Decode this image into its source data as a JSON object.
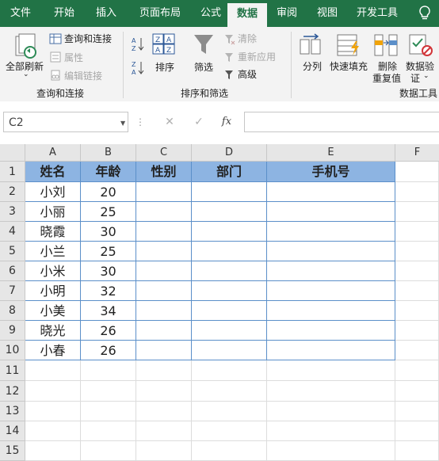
{
  "tabs": [
    {
      "label": "文件",
      "active": false
    },
    {
      "label": "开始",
      "active": false
    },
    {
      "label": "插入",
      "active": false
    },
    {
      "label": "页面布局",
      "active": false
    },
    {
      "label": "公式",
      "active": false
    },
    {
      "label": "数据",
      "active": true
    },
    {
      "label": "审阅",
      "active": false
    },
    {
      "label": "视图",
      "active": false
    },
    {
      "label": "开发工具",
      "active": false
    }
  ],
  "help_icon": "lightbulb-icon",
  "ribbon": {
    "refresh_all_line1": "全部刷新",
    "query_connect": "查询和连接",
    "properties": "属性",
    "edit_links": "编辑链接",
    "group_query": "查询和连接",
    "sort": "排序",
    "filter": "筛选",
    "clear": "清除",
    "reapply": "重新应用",
    "advanced": "高级",
    "group_sort": "排序和筛选",
    "text_to_columns": "分列",
    "flash_fill": "快速填充",
    "remove_dup_line1": "删除",
    "remove_dup_line2": "重复值",
    "validation_line1": "数据验",
    "validation_line2": "证",
    "group_tools": "数据工具"
  },
  "formula_bar": {
    "name_box": "C2",
    "cancel": "✕",
    "enter": "✓",
    "fx": "fx",
    "formula": ""
  },
  "sheet": {
    "columns": [
      "A",
      "B",
      "C",
      "D",
      "E",
      "F"
    ],
    "rows": [
      "1",
      "2",
      "3",
      "4",
      "5",
      "6",
      "7",
      "8",
      "9",
      "10",
      "11",
      "12",
      "13",
      "14",
      "15"
    ],
    "header_row": [
      "姓名",
      "年龄",
      "性别",
      "部门",
      "手机号"
    ],
    "data": [
      [
        "小刘",
        "20",
        "",
        "",
        ""
      ],
      [
        "小丽",
        "25",
        "",
        "",
        ""
      ],
      [
        "晓霞",
        "30",
        "",
        "",
        ""
      ],
      [
        "小兰",
        "25",
        "",
        "",
        ""
      ],
      [
        "小米",
        "30",
        "",
        "",
        ""
      ],
      [
        "小明",
        "32",
        "",
        "",
        ""
      ],
      [
        "小美",
        "34",
        "",
        "",
        ""
      ],
      [
        "晓光",
        "26",
        "",
        "",
        ""
      ],
      [
        "小春",
        "26",
        "",
        "",
        ""
      ]
    ],
    "header_fill": "#8db4e2",
    "table_border": "#5b8fc9",
    "selected_cell": "C2"
  }
}
